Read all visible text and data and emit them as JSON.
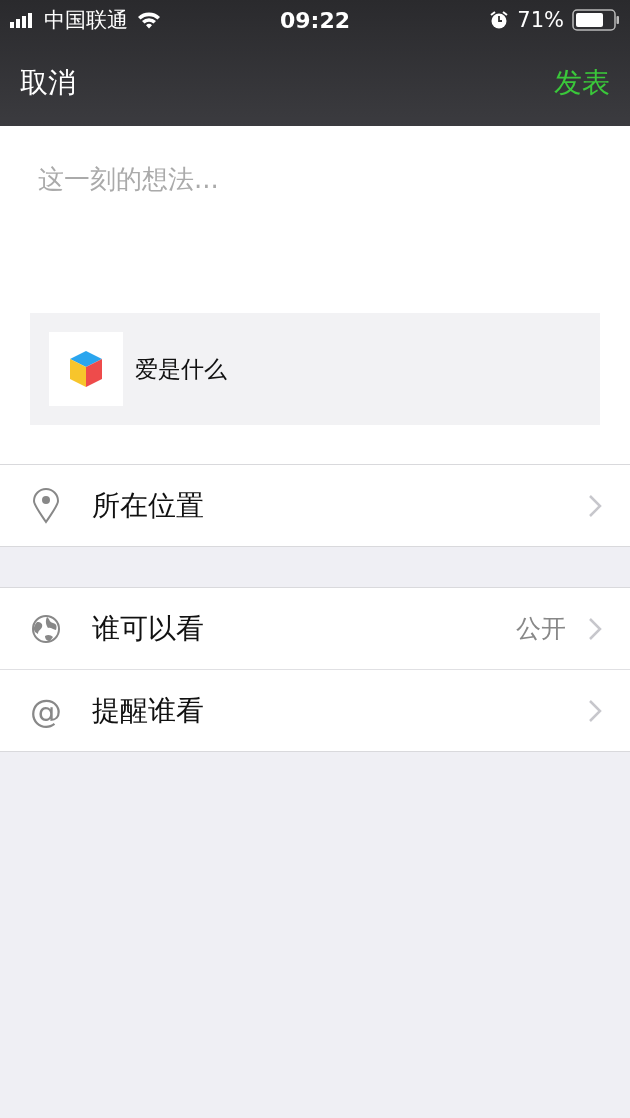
{
  "status_bar": {
    "carrier": "中国联通",
    "time": "09:22",
    "battery": "71%"
  },
  "nav": {
    "cancel": "取消",
    "publish": "发表"
  },
  "compose": {
    "placeholder": "这一刻的想法..."
  },
  "link_card": {
    "title": "爱是什么"
  },
  "sections": [
    [
      {
        "kind": "location",
        "label": "所在位置"
      }
    ],
    [
      {
        "kind": "visibility",
        "label": "谁可以看",
        "value": "公开"
      },
      {
        "kind": "mention",
        "label": "提醒谁看",
        "symbol": "@"
      }
    ]
  ]
}
